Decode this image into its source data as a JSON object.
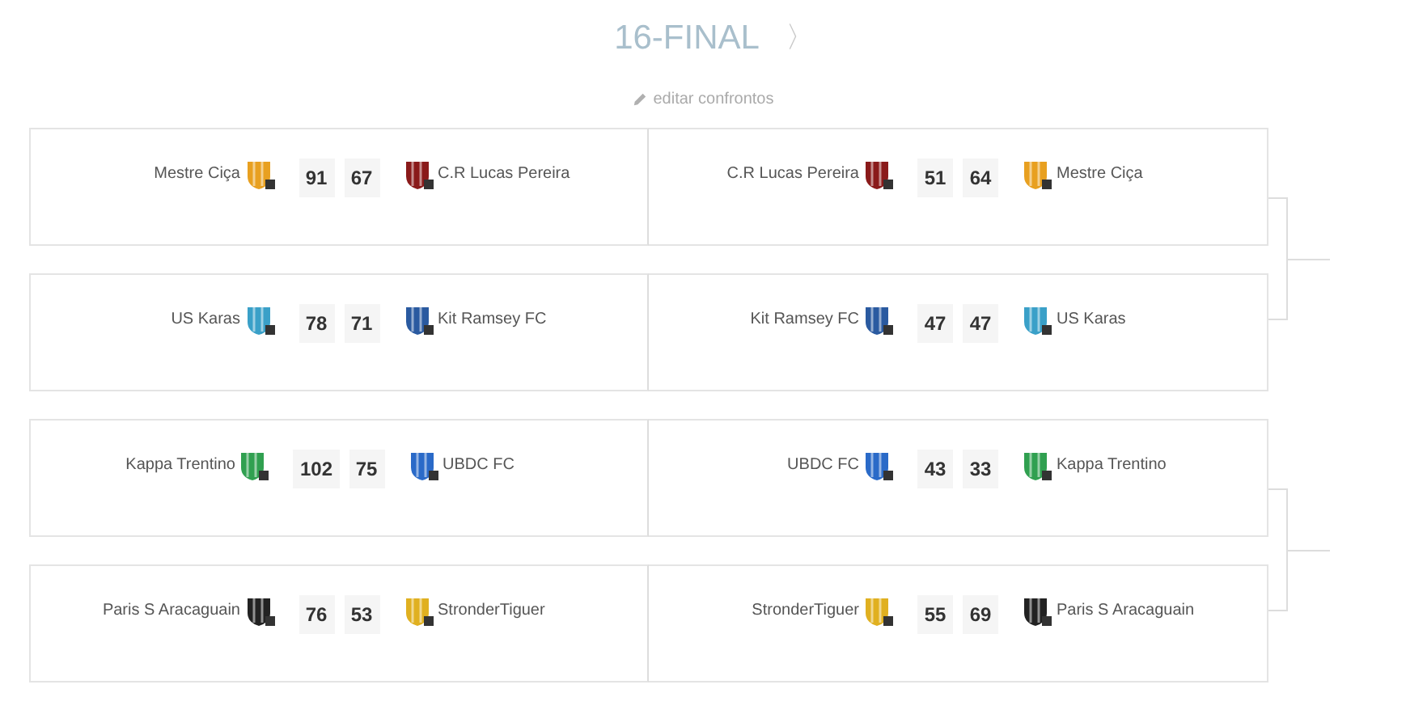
{
  "header": {
    "title": "16-FINAL",
    "next_arrow": "〉",
    "edit_link": "editar confrontos"
  },
  "brackets": [
    {
      "ties": [
        {
          "legs": [
            {
              "home": {
                "name": "Mestre Ciça",
                "color": "#e8a020"
              },
              "home_score": "91",
              "away_score": "67",
              "away": {
                "name": "C.R Lucas Pereira",
                "color": "#8a1a1a"
              }
            },
            {
              "home": {
                "name": "C.R Lucas Pereira",
                "color": "#8a1a1a"
              },
              "home_score": "51",
              "away_score": "64",
              "away": {
                "name": "Mestre Ciça",
                "color": "#e8a020"
              }
            }
          ]
        },
        {
          "legs": [
            {
              "home": {
                "name": "US Karas",
                "color": "#3aa0c8"
              },
              "home_score": "78",
              "away_score": "71",
              "away": {
                "name": "Kit Ramsey FC",
                "color": "#2a5aa0"
              }
            },
            {
              "home": {
                "name": "Kit Ramsey FC",
                "color": "#2a5aa0"
              },
              "home_score": "47",
              "away_score": "47",
              "away": {
                "name": "US Karas",
                "color": "#3aa0c8"
              }
            }
          ]
        }
      ]
    },
    {
      "ties": [
        {
          "legs": [
            {
              "home": {
                "name": "Kappa Trentino",
                "color": "#30a050"
              },
              "home_score": "102",
              "away_score": "75",
              "away": {
                "name": "UBDC FC",
                "color": "#2a6ac8"
              }
            },
            {
              "home": {
                "name": "UBDC FC",
                "color": "#2a6ac8"
              },
              "home_score": "43",
              "away_score": "33",
              "away": {
                "name": "Kappa Trentino",
                "color": "#30a050"
              }
            }
          ]
        },
        {
          "legs": [
            {
              "home": {
                "name": "Paris S Aracaguain",
                "color": "#222222"
              },
              "home_score": "76",
              "away_score": "53",
              "away": {
                "name": "StronderTiguer",
                "color": "#e0b020"
              }
            },
            {
              "home": {
                "name": "StronderTiguer",
                "color": "#e0b020"
              },
              "home_score": "55",
              "away_score": "69",
              "away": {
                "name": "Paris S Aracaguain",
                "color": "#222222"
              }
            }
          ]
        }
      ]
    }
  ]
}
